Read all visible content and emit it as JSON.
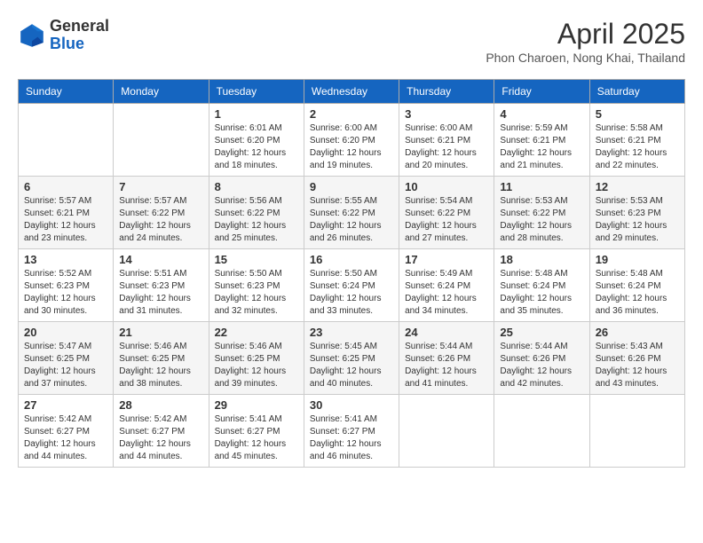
{
  "header": {
    "logo_line1": "General",
    "logo_line2": "Blue",
    "month_year": "April 2025",
    "location": "Phon Charoen, Nong Khai, Thailand"
  },
  "weekdays": [
    "Sunday",
    "Monday",
    "Tuesday",
    "Wednesday",
    "Thursday",
    "Friday",
    "Saturday"
  ],
  "weeks": [
    [
      {
        "day": "",
        "info": ""
      },
      {
        "day": "",
        "info": ""
      },
      {
        "day": "1",
        "info": "Sunrise: 6:01 AM\nSunset: 6:20 PM\nDaylight: 12 hours and 18 minutes."
      },
      {
        "day": "2",
        "info": "Sunrise: 6:00 AM\nSunset: 6:20 PM\nDaylight: 12 hours and 19 minutes."
      },
      {
        "day": "3",
        "info": "Sunrise: 6:00 AM\nSunset: 6:21 PM\nDaylight: 12 hours and 20 minutes."
      },
      {
        "day": "4",
        "info": "Sunrise: 5:59 AM\nSunset: 6:21 PM\nDaylight: 12 hours and 21 minutes."
      },
      {
        "day": "5",
        "info": "Sunrise: 5:58 AM\nSunset: 6:21 PM\nDaylight: 12 hours and 22 minutes."
      }
    ],
    [
      {
        "day": "6",
        "info": "Sunrise: 5:57 AM\nSunset: 6:21 PM\nDaylight: 12 hours and 23 minutes."
      },
      {
        "day": "7",
        "info": "Sunrise: 5:57 AM\nSunset: 6:22 PM\nDaylight: 12 hours and 24 minutes."
      },
      {
        "day": "8",
        "info": "Sunrise: 5:56 AM\nSunset: 6:22 PM\nDaylight: 12 hours and 25 minutes."
      },
      {
        "day": "9",
        "info": "Sunrise: 5:55 AM\nSunset: 6:22 PM\nDaylight: 12 hours and 26 minutes."
      },
      {
        "day": "10",
        "info": "Sunrise: 5:54 AM\nSunset: 6:22 PM\nDaylight: 12 hours and 27 minutes."
      },
      {
        "day": "11",
        "info": "Sunrise: 5:53 AM\nSunset: 6:22 PM\nDaylight: 12 hours and 28 minutes."
      },
      {
        "day": "12",
        "info": "Sunrise: 5:53 AM\nSunset: 6:23 PM\nDaylight: 12 hours and 29 minutes."
      }
    ],
    [
      {
        "day": "13",
        "info": "Sunrise: 5:52 AM\nSunset: 6:23 PM\nDaylight: 12 hours and 30 minutes."
      },
      {
        "day": "14",
        "info": "Sunrise: 5:51 AM\nSunset: 6:23 PM\nDaylight: 12 hours and 31 minutes."
      },
      {
        "day": "15",
        "info": "Sunrise: 5:50 AM\nSunset: 6:23 PM\nDaylight: 12 hours and 32 minutes."
      },
      {
        "day": "16",
        "info": "Sunrise: 5:50 AM\nSunset: 6:24 PM\nDaylight: 12 hours and 33 minutes."
      },
      {
        "day": "17",
        "info": "Sunrise: 5:49 AM\nSunset: 6:24 PM\nDaylight: 12 hours and 34 minutes."
      },
      {
        "day": "18",
        "info": "Sunrise: 5:48 AM\nSunset: 6:24 PM\nDaylight: 12 hours and 35 minutes."
      },
      {
        "day": "19",
        "info": "Sunrise: 5:48 AM\nSunset: 6:24 PM\nDaylight: 12 hours and 36 minutes."
      }
    ],
    [
      {
        "day": "20",
        "info": "Sunrise: 5:47 AM\nSunset: 6:25 PM\nDaylight: 12 hours and 37 minutes."
      },
      {
        "day": "21",
        "info": "Sunrise: 5:46 AM\nSunset: 6:25 PM\nDaylight: 12 hours and 38 minutes."
      },
      {
        "day": "22",
        "info": "Sunrise: 5:46 AM\nSunset: 6:25 PM\nDaylight: 12 hours and 39 minutes."
      },
      {
        "day": "23",
        "info": "Sunrise: 5:45 AM\nSunset: 6:25 PM\nDaylight: 12 hours and 40 minutes."
      },
      {
        "day": "24",
        "info": "Sunrise: 5:44 AM\nSunset: 6:26 PM\nDaylight: 12 hours and 41 minutes."
      },
      {
        "day": "25",
        "info": "Sunrise: 5:44 AM\nSunset: 6:26 PM\nDaylight: 12 hours and 42 minutes."
      },
      {
        "day": "26",
        "info": "Sunrise: 5:43 AM\nSunset: 6:26 PM\nDaylight: 12 hours and 43 minutes."
      }
    ],
    [
      {
        "day": "27",
        "info": "Sunrise: 5:42 AM\nSunset: 6:27 PM\nDaylight: 12 hours and 44 minutes."
      },
      {
        "day": "28",
        "info": "Sunrise: 5:42 AM\nSunset: 6:27 PM\nDaylight: 12 hours and 44 minutes."
      },
      {
        "day": "29",
        "info": "Sunrise: 5:41 AM\nSunset: 6:27 PM\nDaylight: 12 hours and 45 minutes."
      },
      {
        "day": "30",
        "info": "Sunrise: 5:41 AM\nSunset: 6:27 PM\nDaylight: 12 hours and 46 minutes."
      },
      {
        "day": "",
        "info": ""
      },
      {
        "day": "",
        "info": ""
      },
      {
        "day": "",
        "info": ""
      }
    ]
  ]
}
